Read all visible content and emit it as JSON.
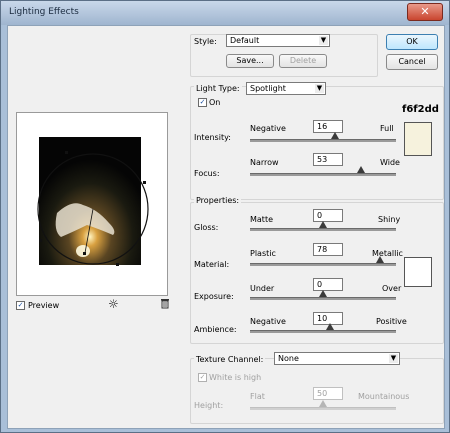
{
  "window": {
    "title": "Lighting Effects",
    "close_glyph": "✕"
  },
  "style": {
    "label": "Style:",
    "value": "Default",
    "save_label": "Save...",
    "delete_label": "Delete"
  },
  "buttons": {
    "ok": "OK",
    "cancel": "Cancel"
  },
  "light_type": {
    "label": "Light Type:",
    "value": "Spotlight",
    "on_label": "On",
    "on_checked": true,
    "color_hex": "f6f2dd",
    "color": "#f6f2dd",
    "intensity": {
      "label": "Intensity:",
      "min": "Negative",
      "max": "Full",
      "value": "16",
      "level_pct": 58
    },
    "focus": {
      "label": "Focus:",
      "min": "Narrow",
      "max": "Wide",
      "value": "53",
      "level_pct": 76
    }
  },
  "properties": {
    "title": "Properties:",
    "gloss": {
      "label": "Gloss:",
      "min": "Matte",
      "max": "Shiny",
      "value": "0",
      "level_pct": 50
    },
    "material": {
      "label": "Material:",
      "min": "Plastic",
      "max": "Metallic",
      "value": "78",
      "level_pct": 89
    },
    "exposure": {
      "label": "Exposure:",
      "min": "Under",
      "max": "Over",
      "value": "0",
      "level_pct": 50
    },
    "ambience": {
      "label": "Ambience:",
      "min": "Negative",
      "max": "Positive",
      "value": "10",
      "level_pct": 55
    },
    "swatch_color": "#ffffff"
  },
  "texture": {
    "label": "Texture Channel:",
    "value": "None",
    "white_high_label": "White is high",
    "white_high_checked": true,
    "height": {
      "label": "Height:",
      "min": "Flat",
      "max": "Mountainous",
      "value": "50",
      "level_pct": 50
    }
  },
  "preview": {
    "label": "Preview",
    "checked": true,
    "light_icon": "lightbulb-icon",
    "trash_icon": "trash-icon"
  }
}
